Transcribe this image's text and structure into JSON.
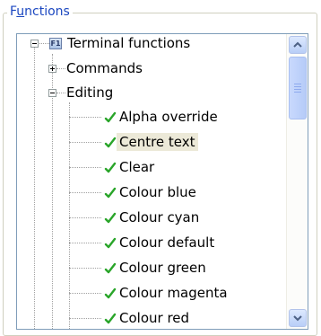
{
  "groupbox": {
    "title": "Functions",
    "mnemonic": "u"
  },
  "tree": {
    "root": {
      "label": "Terminal functions",
      "icon": "f1-key-icon",
      "expanded": true
    },
    "commands": {
      "label": "Commands",
      "expanded": false
    },
    "editing": {
      "label": "Editing",
      "expanded": true
    },
    "items": [
      {
        "label": "Alpha override",
        "icon": "green-check-icon",
        "selected": false
      },
      {
        "label": "Centre text",
        "icon": "green-check-icon",
        "selected": true
      },
      {
        "label": "Clear",
        "icon": "green-check-icon",
        "selected": false
      },
      {
        "label": "Colour blue",
        "icon": "green-check-icon",
        "selected": false
      },
      {
        "label": "Colour cyan",
        "icon": "green-check-icon",
        "selected": false
      },
      {
        "label": "Colour default",
        "icon": "green-check-icon",
        "selected": false
      },
      {
        "label": "Colour green",
        "icon": "green-check-icon",
        "selected": false
      },
      {
        "label": "Colour magenta",
        "icon": "green-check-icon",
        "selected": false
      },
      {
        "label": "Colour red",
        "icon": "green-check-icon",
        "selected": false
      }
    ]
  },
  "colors": {
    "group_title": "#1b47c0",
    "check": "#2aa52a",
    "selection": "#ece9d8",
    "border": "#7f9db9"
  },
  "scrollbar": {
    "position_fraction": 0.0
  }
}
